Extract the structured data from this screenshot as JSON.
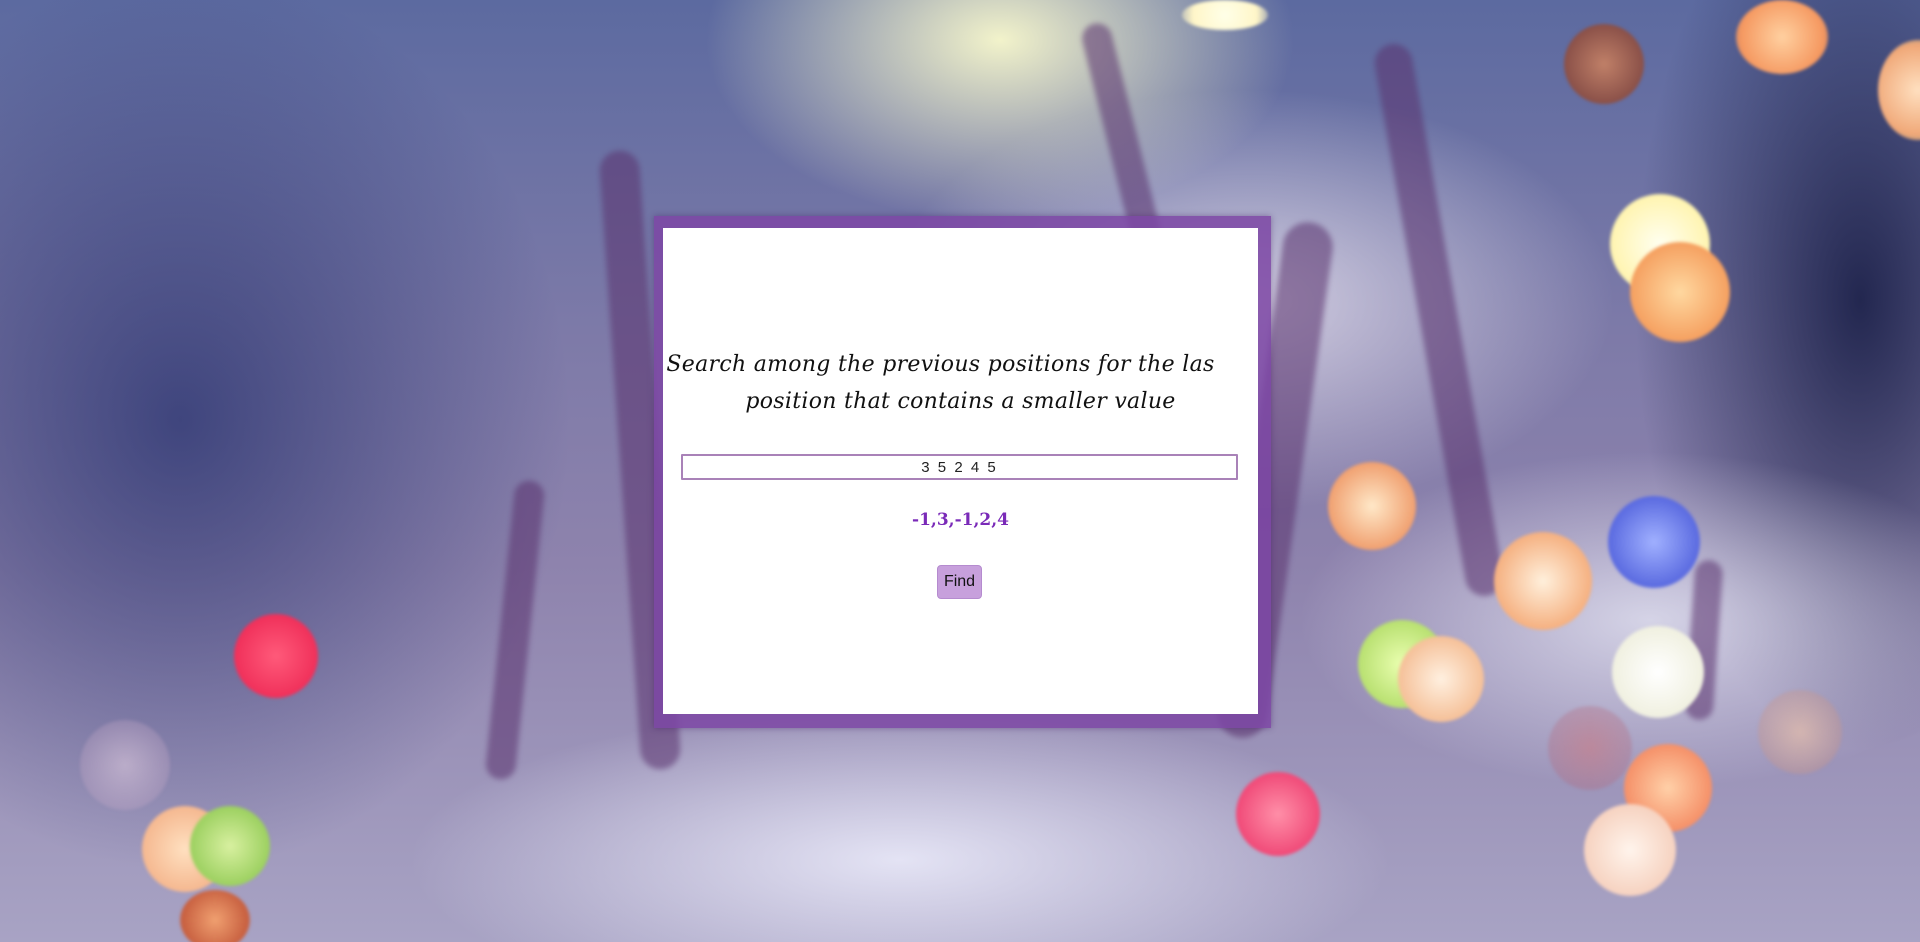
{
  "card": {
    "title_line1": "Search among the previous positions for the las",
    "title_line2": "position that contains a smaller value"
  },
  "input": {
    "value": "3 5 2 4 5"
  },
  "result": {
    "text": "-1,3,-1,2,4"
  },
  "find_button": {
    "label": "Find"
  },
  "colors": {
    "accent": "#7a2ab8",
    "frame": "#7d46a5",
    "button": "#c7a0dc"
  }
}
